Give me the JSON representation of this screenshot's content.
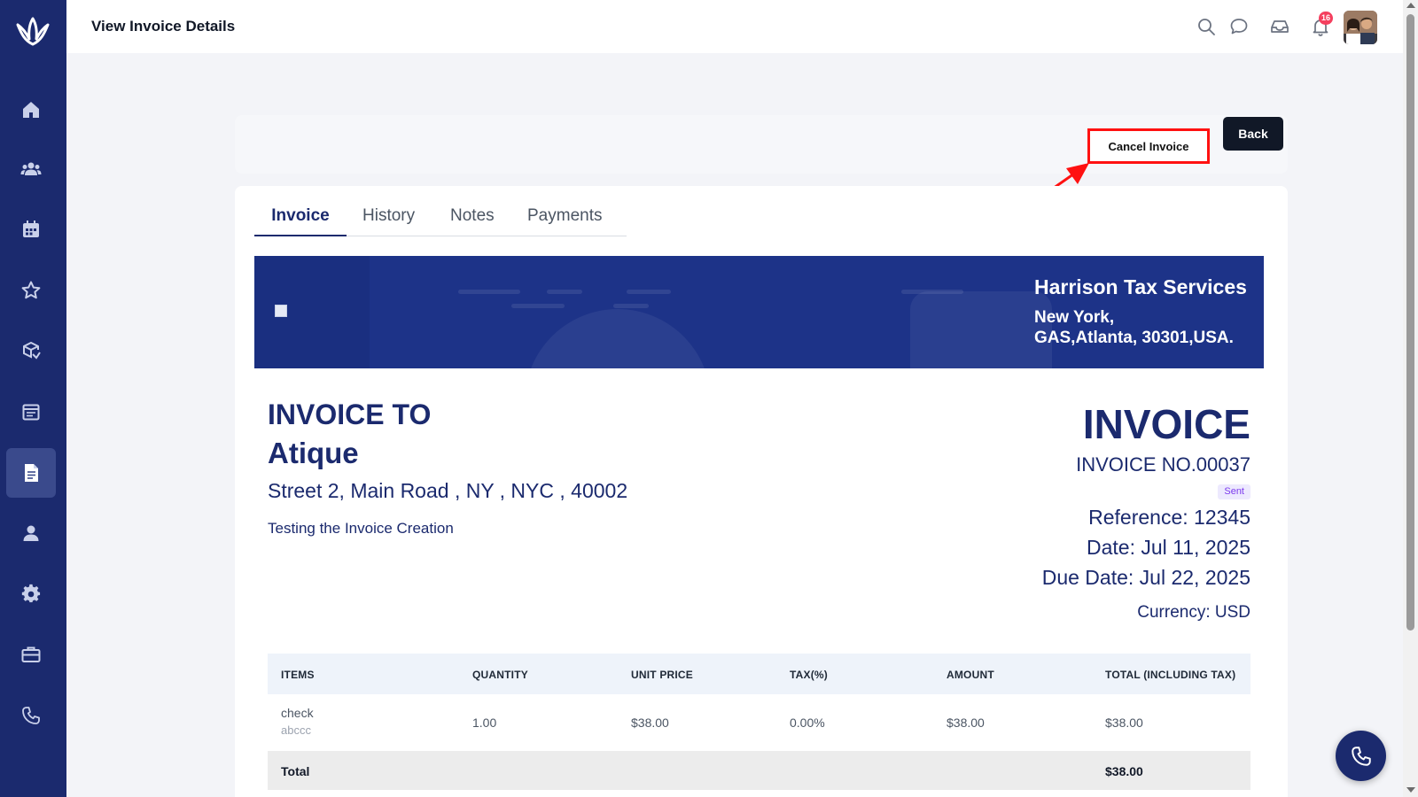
{
  "header": {
    "title": "View Invoice Details",
    "notification_count": "16",
    "icons": [
      "search-icon",
      "chat-icon",
      "inbox-icon",
      "bell-icon"
    ]
  },
  "sidebar": {
    "items": [
      {
        "name": "home-icon"
      },
      {
        "name": "users-icon"
      },
      {
        "name": "calendar-icon"
      },
      {
        "name": "star-icon"
      },
      {
        "name": "box-icon"
      },
      {
        "name": "calendar-note-icon"
      },
      {
        "name": "invoice-icon",
        "active": true
      },
      {
        "name": "user-icon"
      },
      {
        "name": "gear-icon"
      },
      {
        "name": "briefcase-icon"
      },
      {
        "name": "phone-icon"
      }
    ]
  },
  "actions": {
    "cancel_label": "Cancel Invoice",
    "back_label": "Back"
  },
  "tabs": [
    {
      "label": "Invoice",
      "active": true
    },
    {
      "label": "History"
    },
    {
      "label": "Notes"
    },
    {
      "label": "Payments"
    }
  ],
  "company": {
    "name": "Harrison Tax Services",
    "address_line1": "New York,",
    "address_line2": "GAS,Atlanta, 30301,USA."
  },
  "bill_to": {
    "heading": "INVOICE TO",
    "name": "Atique",
    "address": "Street 2, Main Road , NY , NYC , 40002",
    "note": "Testing the Invoice Creation"
  },
  "invoice": {
    "title": "INVOICE",
    "number": "INVOICE NO.00037",
    "status": "Sent",
    "reference": "Reference: 12345",
    "date": "Date: Jul 11, 2025",
    "due_date": "Due Date: Jul 22, 2025",
    "currency": "Currency: USD"
  },
  "items_table": {
    "columns": [
      "ITEMS",
      "QUANTITY",
      "UNIT PRICE",
      "TAX(%)",
      "AMOUNT",
      "TOTAL (INCLUDING TAX)"
    ],
    "rows": [
      {
        "item": "check",
        "description": "abccc",
        "quantity": "1.00",
        "unit_price": "$38.00",
        "tax": "0.00%",
        "amount": "$38.00",
        "total": "$38.00"
      }
    ],
    "footer_label": "Total",
    "footer_total": "$38.00"
  },
  "colors": {
    "sidebar": "#1b2a6e",
    "banner": "#1d3388",
    "accent": "#1b2a6e",
    "highlight": "#ff1111",
    "status_badge_bg": "#ede9fe"
  }
}
